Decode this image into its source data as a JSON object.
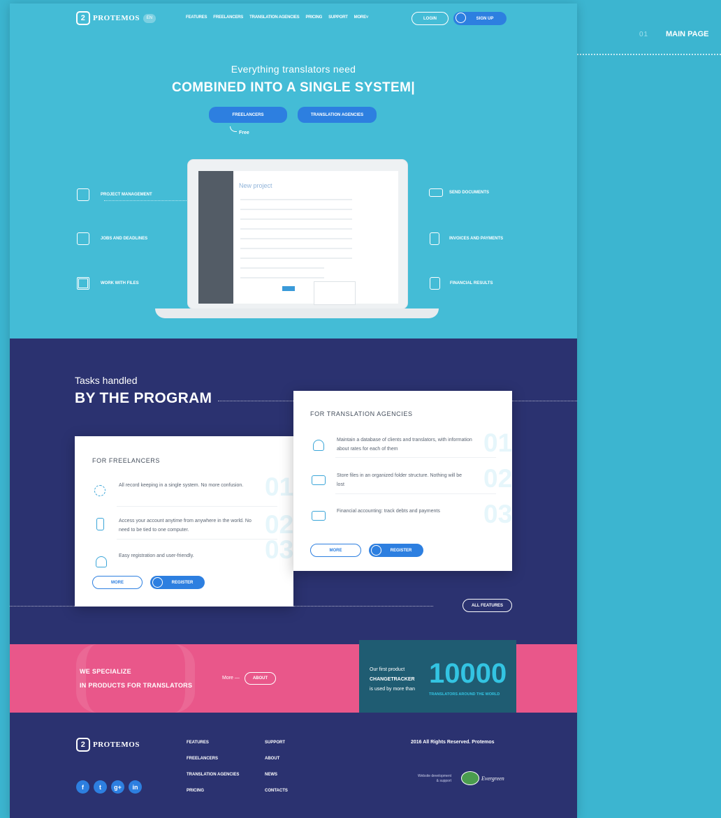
{
  "side": {
    "number": "01",
    "title": "MAIN PAGE"
  },
  "header": {
    "brand": "PROTEMOS",
    "lang": "EN",
    "nav": [
      "FEATURES",
      "FREELANCERS",
      "TRANSLATION AGENCIES",
      "PRICING",
      "SUPPORT",
      "MORE"
    ],
    "login": "LOGIN",
    "signup": "SIGN UP"
  },
  "hero": {
    "subtitle": "Everything translators need",
    "title": "COMBINED INTO A SINGLE SYSTEM|",
    "btn_freelancers": "FREELANCERS",
    "btn_agencies": "TRANSLATION AGENCIES",
    "free_note": "Free"
  },
  "features_left": [
    "PROJECT MANAGEMENT",
    "JOBS AND DEADLINES",
    "WORK WITH FILES"
  ],
  "features_right": [
    "SEND DOCUMENTS",
    "INVOICES AND PAYMENTS",
    "FINANCIAL RESULTS"
  ],
  "laptop": {
    "app_title": "New project"
  },
  "tasks": {
    "subtitle": "Tasks handled",
    "title": "BY THE PROGRAM"
  },
  "freelancers_card": {
    "heading": "FOR FREELANCERS",
    "items": [
      {
        "num": "01",
        "text": "All record keeping in a single system. No more confusion."
      },
      {
        "num": "02",
        "text": "Access your account anytime from anywhere in the world. No need to be tied to one computer."
      },
      {
        "num": "03",
        "text": "Easy registration and user-friendly."
      }
    ],
    "more": "MORE",
    "register": "REGISTER"
  },
  "agencies_card": {
    "heading": "FOR TRANSLATION AGENCIES",
    "items": [
      {
        "num": "01",
        "text": "Maintain a database of clients and translators, with information about rates for each of them"
      },
      {
        "num": "02",
        "text": "Store files in an organized folder structure. Nothing will be lost"
      },
      {
        "num": "03",
        "text": "Financial accounting: track debts and payments"
      }
    ],
    "more": "MORE",
    "register": "REGISTER"
  },
  "all_features": "ALL FEATURES",
  "specialize": {
    "line1": "WE SPECIALIZE",
    "line2": "IN PRODUCTS FOR TRANSLATORS",
    "more": "More —",
    "about": "ABOUT"
  },
  "stat": {
    "line1": "Our first product",
    "line2": "CHANGETRACKER",
    "line3": "is used by more than",
    "number": "10000",
    "caption": "TRANSLATORS AROUND THE WORLD"
  },
  "footer": {
    "brand": "PROTEMOS",
    "col1": [
      "FEATURES",
      "FREELANCERS",
      "TRANSLATION AGENCIES",
      "PRICING"
    ],
    "col2": [
      "SUPPORT",
      "ABOUT",
      "NEWS",
      "CONTACTS"
    ],
    "rights": "2016 All Rights Reserved. Protemos",
    "dev_line1": "Website development",
    "dev_line2": "& support",
    "dev_brand": "Evergreen",
    "social": [
      "f",
      "t",
      "g+",
      "in"
    ]
  },
  "colors": {
    "accent_blue": "#2d7fe0",
    "cyan": "#44bcd6",
    "navy": "#2b3270",
    "pink": "#e9578a"
  }
}
